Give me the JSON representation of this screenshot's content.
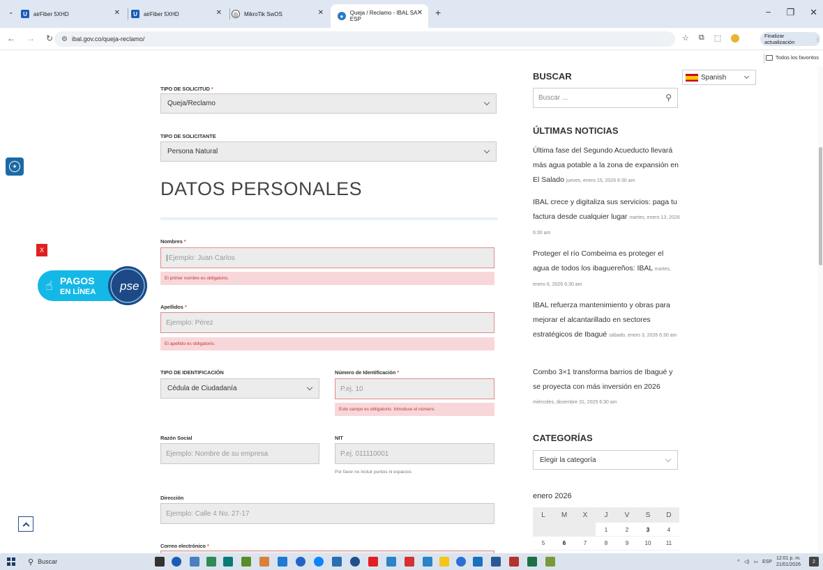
{
  "browser": {
    "tabs": [
      {
        "title": "airFiber 5XHD",
        "active": false
      },
      {
        "title": "airFiber 5XHD",
        "active": false
      },
      {
        "title": "MikroTik SwOS",
        "active": false
      },
      {
        "title": "Queja / Reclamo - IBAL SA ESP",
        "active": true
      }
    ],
    "new_tab": "+",
    "url": "ibal.gov.co/queja-reclamo/",
    "finalize_label": "Finalizar actualización",
    "bookmarks_folder": "Todos los favoritos"
  },
  "form": {
    "tipo_solicitud_label": "TIPO DE SOLICITUD",
    "tipo_solicitud_value": "Queja/Reclamo",
    "tipo_solicitante_label": "TIPO DE SOLICITANTE",
    "tipo_solicitante_value": "Persona Natural",
    "section_title": "DATOS PERSONALES",
    "nombres_label": "Nombres",
    "nombres_placeholder": "Ejemplo: Juan Carlos",
    "nombres_error": "El primer nombre es obligatorio.",
    "apellidos_label": "Apellidos",
    "apellidos_placeholder": "Ejemplo: Pérez",
    "apellidos_error": "El apellido es obligatorio.",
    "tipo_id_label": "TIPO DE IDENTIFICACIÓN",
    "tipo_id_value": "Cédula de Ciudadanía",
    "num_id_label": "Número de Identificación",
    "num_id_placeholder": "P.ej. 10",
    "num_id_error": "Este campo es obligatorio. Introduce el número.",
    "razon_label": "Razón Social",
    "razon_placeholder": "Ejemplo: Nombre de su empresa",
    "nit_label": "NIT",
    "nit_placeholder": "P.ej. 011110001",
    "nit_hint": "Por favor no incluir puntos ni espacios",
    "direccion_label": "Dirección",
    "direccion_placeholder": "Ejemplo: Calle 4 No. 27-17",
    "correo_label": "Correo electrónico",
    "required_mark": "*"
  },
  "sidebar": {
    "buscar_title": "BUSCAR",
    "buscar_placeholder": "Buscar ...",
    "language": "Spanish",
    "noticias_title": "ÚLTIMAS NOTICIAS",
    "news": [
      {
        "title": "Última fase del Segundo Acueducto llevará más agua potable a la zona de expansión en El Salado",
        "date": "jueves, enero 15, 2026 6:30 am"
      },
      {
        "title": "IBAL crece y digitaliza sus servicios: paga tu factura desde cualquier lugar",
        "date": "martes, enero 13, 2026 6:30 am"
      },
      {
        "title": "Proteger el río Combeima es proteger el agua de todos los ibaguereños: IBAL",
        "date": "martes, enero 6, 2026 6:30 am"
      },
      {
        "title": "IBAL refuerza mantenimiento y obras para mejorar el alcantarillado en sectores estratégicos de Ibagué",
        "date": "sábado, enero 3, 2026 6:30 am"
      },
      {
        "title": "Combo 3×1 transforma barrios de Ibagué y se proyecta con más inversión en 2026",
        "date": "miércoles, diciembre 31, 2025 6:30 am"
      }
    ],
    "categorias_title": "CATEGORÍAS",
    "categorias_value": "Elegir la categoría",
    "calendar_month": "enero 2026",
    "calendar_days": [
      "L",
      "M",
      "X",
      "J",
      "V",
      "S",
      "D"
    ],
    "calendar_rows": [
      [
        "",
        "",
        "",
        "1",
        "2",
        "3",
        "4"
      ],
      [
        "5",
        "6",
        "7",
        "8",
        "9",
        "10",
        "11"
      ]
    ]
  },
  "widgets": {
    "close_label": "X",
    "pagos_line1": "PAGOS",
    "pagos_line2": "EN LÍNEA",
    "pse_label": "pse"
  },
  "taskbar": {
    "search_label": "Buscar",
    "lang": "ESP",
    "time": "12:01 p. m.",
    "date": "21/01/2026",
    "notif_count": "2"
  }
}
